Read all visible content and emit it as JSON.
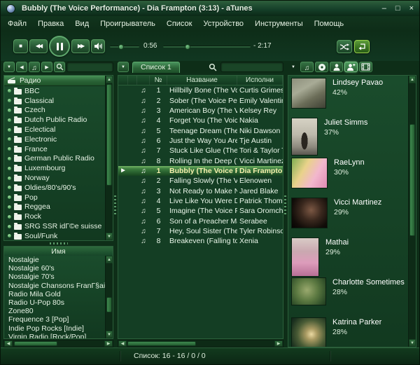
{
  "window": {
    "title": "Bubbly (The Voice Performance) - Dia Frampton (3:13) - aTunes",
    "controls": {
      "minimize": "–",
      "maximize": "□",
      "close": "×"
    }
  },
  "menu": {
    "items": [
      "Файл",
      "Правка",
      "Вид",
      "Проигрыватель",
      "Список",
      "Устройство",
      "Инструменты",
      "Помощь"
    ]
  },
  "player": {
    "elapsed": "0:56",
    "remaining": "- 2:17",
    "volume_thumb_style": "left:38%",
    "progress_thumb_style": "left:28%"
  },
  "nav": {
    "search_value": "",
    "tree": {
      "header": "Радио",
      "items": [
        "BBC",
        "Classical",
        "Czech",
        "Dutch Public Radio",
        "Eclectical",
        "Electronic",
        "France",
        "German Public Radio",
        "Luxembourg",
        "Norway",
        "Oldies/80's/90's",
        "Pop",
        "Reggea",
        "Rock",
        "SRG SSR idГ©e suisse",
        "Soul/Funk"
      ]
    },
    "stations": {
      "header": "Имя",
      "items": [
        "Nostalgie",
        "Nostalgie 60's",
        "Nostalgie 70's",
        "Nostalgie Chansons FranГ§aises",
        "Radio Mila Gold",
        "Radio U-Pop 80s",
        "Zone80",
        "Frequence 3 [Pop]",
        "Indie Pop Rocks [Indie]",
        "Virgin Radio [Rock/Pop]"
      ]
    }
  },
  "playlist": {
    "tab": "Список 1",
    "search_value": "",
    "columns": {
      "num": "№",
      "title": "Название",
      "artist": "Исполни"
    },
    "rows": [
      {
        "num": "1",
        "title": "Hillbilly Bone (The Voice ...",
        "artist": "Curtis Grimes"
      },
      {
        "num": "2",
        "title": "Sober (The Voice Perform...",
        "artist": "Emily Valentine"
      },
      {
        "num": "3",
        "title": "American Boy (The Voice ...",
        "artist": "Kelsey Rey"
      },
      {
        "num": "4",
        "title": "Forget You (The Voice Pe...",
        "artist": "Nakia"
      },
      {
        "num": "5",
        "title": "Teenage Dream (The Voic...",
        "artist": "Niki Dawson"
      },
      {
        "num": "6",
        "title": "Just the Way You Are (Th...",
        "artist": "Tje Austin"
      },
      {
        "num": "7",
        "title": "Stuck Like Glue (The Voic...",
        "artist": "Tori & Taylor Th"
      },
      {
        "num": "8",
        "title": "Rolling In the Deep (The ...",
        "artist": "Vicci Martinez"
      },
      {
        "num": "1",
        "title": "Bubbly (The Voice Perfo...",
        "artist": "Dia Frampton",
        "current": true
      },
      {
        "num": "2",
        "title": "Falling Slowly (The Voice ...",
        "artist": "Elenowen"
      },
      {
        "num": "3",
        "title": "Not Ready to Make Nice (...",
        "artist": "Jared Blake"
      },
      {
        "num": "4",
        "title": "Live Like You Were Dying ...",
        "artist": "Patrick Thomas"
      },
      {
        "num": "5",
        "title": "Imagine (The Voice Perfo...",
        "artist": "Sara Oromchi"
      },
      {
        "num": "6",
        "title": "Son of a Preacher Man (T...",
        "artist": "Serabee"
      },
      {
        "num": "7",
        "title": "Hey, Soul Sister (The Voic...",
        "artist": "Tyler Robinson"
      },
      {
        "num": "8",
        "title": "Breakeven (Falling to Piec...",
        "artist": "Xenia"
      }
    ]
  },
  "context": {
    "artists": [
      {
        "name": "Lindsey Pavao",
        "match": "42%",
        "photo_style": "width:50px;height:44px;background:linear-gradient(150deg,#8d8f7c 0%,#a8ab96 35%,#6b6d58 65%,#3e4034 100%)"
      },
      {
        "name": "Juliet Simms",
        "match": "37%",
        "photo_style": "width:38px;height:54px;background:radial-gradient(ellipse 30% 55% at 50% 62%,#2a2620 0%,#2a2620 42%,rgba(0,0,0,0) 43%),linear-gradient(180deg,#d6d2c4 0%,#bdb9ab 45%,#8e8a7e 78%,#5a5750 100%)"
      },
      {
        "name": "RaeLynn",
        "match": "30%",
        "photo_style": "width:52px;height:44px;background:linear-gradient(120deg,#7fae52 0%,#e9d28a 35%,#f2b7cd 65%,#e08bb4 100%)"
      },
      {
        "name": "Vicci Martinez",
        "match": "29%",
        "photo_style": "width:52px;height:44px;background:radial-gradient(circle at 55% 40%,#7c5844 0%,#3a281e 40%,#120d09 75%,#060404 100%)"
      },
      {
        "name": "Mathai",
        "match": "29%",
        "photo_style": "width:40px;height:56px;background:linear-gradient(180deg,#d9cbc6 0%,#caa8b0 35%,#dd9cbb 65%,#b76f96 100%)"
      },
      {
        "name": "Charlotte Sometimes",
        "match": "28%",
        "photo_style": "width:50px;height:40px;background:radial-gradient(circle at 45% 45%,#9aa96e 0%,#5d7a42 45%,#33522b 80%,#1f3a1e 100%)"
      },
      {
        "name": "Katrina Parker",
        "match": "28%",
        "photo_style": "width:50px;height:44px;background:radial-gradient(circle at 58% 55%,#ead9a2 0%,#a99a62 22%,#4a5c36 55%,#1d3320 85%,#12251a 100%)"
      }
    ]
  },
  "status": {
    "text": "Список: 16 - 16 / 0 / 0"
  },
  "colors": {
    "window_bg": "#0e2e18",
    "panel_border": "#2b5f3a",
    "selection": "#3f8a50",
    "current_track_text": "#f6f0ae"
  }
}
